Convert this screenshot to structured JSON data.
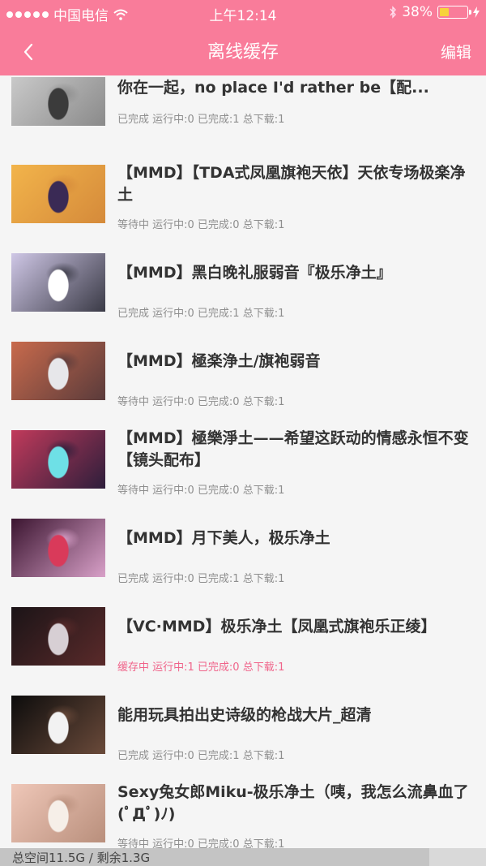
{
  "status_bar": {
    "carrier": "中国电信",
    "time": "上午12:14",
    "battery": "38%",
    "battery_level": 0.38
  },
  "nav": {
    "title": "离线缓存",
    "edit_label": "编辑"
  },
  "items": [
    {
      "title": "【解毒向MMD】弱音：极乐净土虽好，但是只要跟你在一起，no place I'd rather be【配...",
      "meta": "已完成 运行中:0 已完成:1 总下载:1",
      "thumb_colors": [
        "#c9c9c9",
        "#3b3b3b",
        "#8a8a8a"
      ],
      "active": false
    },
    {
      "title": "【MMD】【TDA式凤凰旗袍天依】天依专场极楽净土",
      "meta": "等待中 运行中:0 已完成:0 总下载:1",
      "thumb_colors": [
        "#f2b44b",
        "#3a2a55",
        "#d58a3a"
      ],
      "active": false
    },
    {
      "title": "【MMD】黑白晚礼服弱音『极乐净土』",
      "meta": "已完成 运行中:0 已完成:1 总下载:1",
      "thumb_colors": [
        "#cfc7e6",
        "#ffffff",
        "#3a3a46"
      ],
      "active": false
    },
    {
      "title": "【MMD】極楽浄土/旗袍弱音",
      "meta": "等待中 运行中:0 已完成:0 总下载:1",
      "thumb_colors": [
        "#c86a4c",
        "#e7e7ea",
        "#5a3b3b"
      ],
      "active": false
    },
    {
      "title": "【MMD】極樂淨土——希望这跃动的情感永恒不变【镜头配布】",
      "meta": "等待中 运行中:0 已完成:0 总下载:1",
      "thumb_colors": [
        "#c13a5b",
        "#6ee0e6",
        "#2d1e3b"
      ],
      "active": false
    },
    {
      "title": "【MMD】月下美人，极乐净土",
      "meta": "已完成 运行中:0 已完成:1 总下载:1",
      "thumb_colors": [
        "#3b1530",
        "#d93a5a",
        "#d8a0c8"
      ],
      "active": false
    },
    {
      "title": "【VC·MMD】极乐净土【凤凰式旗袍乐正绫】",
      "meta": "缓存中 运行中:1 已完成:0 总下载:1",
      "thumb_colors": [
        "#1b1417",
        "#d7cfd4",
        "#5a2a2a"
      ],
      "active": true
    },
    {
      "title": "能用玩具拍出史诗级的枪战大片_超清",
      "meta": "已完成 运行中:0 已完成:1 总下载:1",
      "thumb_colors": [
        "#0c0c0c",
        "#f2f2f2",
        "#6a4a3a"
      ],
      "active": false
    },
    {
      "title": "Sexy兔女郎Miku-极乐净土（咦，我怎么流鼻血了(ﾟДﾟ)ﾉ)",
      "meta": "等待中 运行中:0 已完成:0 总下载:1",
      "thumb_colors": [
        "#efc7b8",
        "#f6efe8",
        "#b98f7c"
      ],
      "active": false
    }
  ],
  "footer": {
    "storage_label": "总空间11.5G / 剩余1.3G"
  }
}
